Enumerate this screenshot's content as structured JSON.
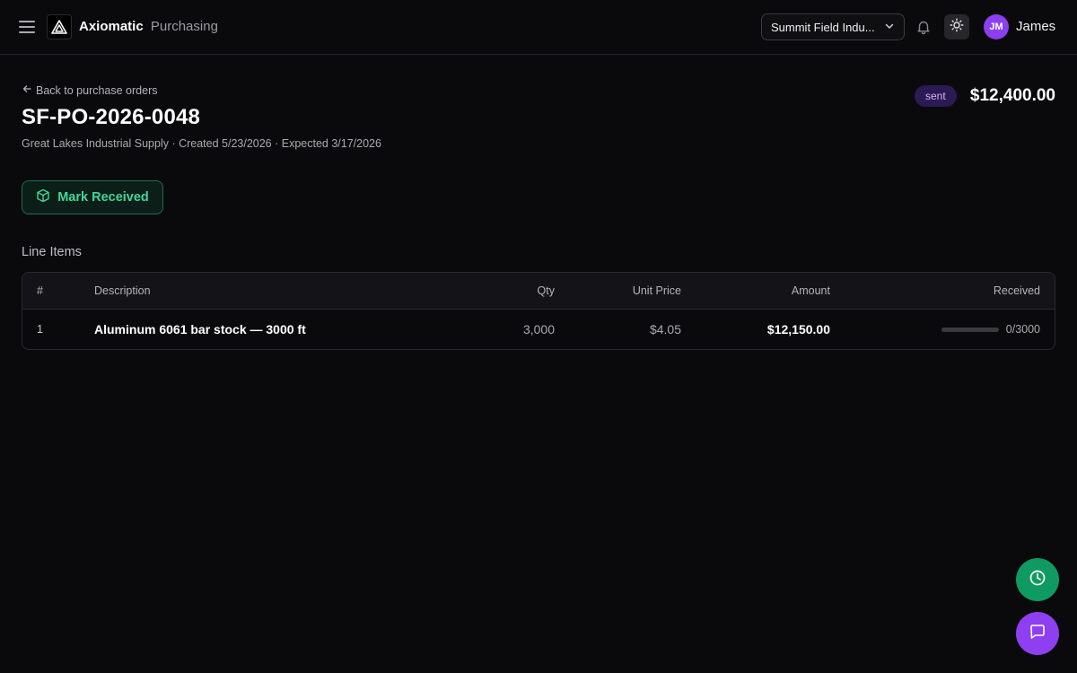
{
  "app": {
    "brand": "Axiomatic",
    "module": "Purchasing"
  },
  "header": {
    "org_selector_value": "Summit Field Indu...",
    "user_initials": "JM",
    "user_name": "James",
    "icons": [
      "menu-icon",
      "logo-icon",
      "chevron-down-icon",
      "bell-icon",
      "sun-icon"
    ]
  },
  "po": {
    "back_label": "Back to purchase orders",
    "number": "SF-PO-2026-0048",
    "meta": "Great Lakes Industrial Supply · Created 5/23/2026 · Expected 3/17/2026",
    "status": "sent",
    "total": "$12,400.00",
    "mark_received_label": "Mark Received"
  },
  "line_items": {
    "title": "Line Items",
    "columns": {
      "num": "#",
      "description": "Description",
      "qty": "Qty",
      "unit_price": "Unit Price",
      "amount": "Amount",
      "received": "Received"
    },
    "rows": [
      {
        "num": "1",
        "description": "Aluminum 6061 bar stock — 3000 ft",
        "qty": "3,000",
        "unit_price": "$4.05",
        "amount": "$12,150.00",
        "received_text": "0/3000",
        "received_fraction": 0
      }
    ]
  },
  "colors": {
    "accent_green": "#45d49a",
    "status_purple": "#2c1a55",
    "fab_history": "#0f9a62",
    "fab_chat": "#8e3ff2"
  }
}
